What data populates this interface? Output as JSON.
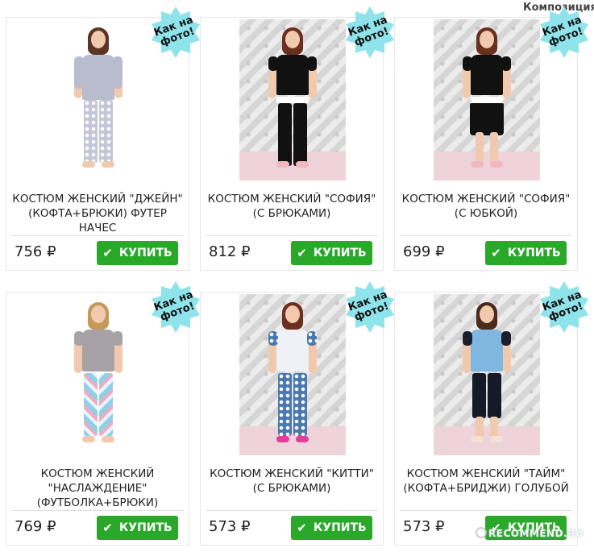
{
  "header": {
    "label": "Композиция"
  },
  "badge_text": "Как на фото!",
  "buy_label": "КУПИТЬ",
  "currency": "₽",
  "products": [
    {
      "title": "КОСТЮМ ЖЕНСКИЙ \"ДЖЕЙН\" (КОФТА+БРЮКИ) ФУТЕР НАЧЕС",
      "price": "756 ₽"
    },
    {
      "title": "КОСТЮМ ЖЕНСКИЙ \"СОФИЯ\" (С БРЮКАМИ)",
      "price": "812 ₽"
    },
    {
      "title": "КОСТЮМ ЖЕНСКИЙ \"СОФИЯ\" (С ЮБКОЙ)",
      "price": "699 ₽"
    },
    {
      "title": "КОСТЮМ ЖЕНСКИЙ \"НАСЛАЖДЕНИЕ\" (ФУТБОЛКА+БРЮКИ)",
      "price": "769 ₽"
    },
    {
      "title": "КОСТЮМ ЖЕНСКИЙ \"КИТТИ\" (С БРЮКАМИ)",
      "price": "573 ₽"
    },
    {
      "title": "КОСТЮМ ЖЕНСКИЙ \"ТАЙМ\" (КОФТА+БРИДЖИ) ГОЛУБОЙ",
      "price": "573 ₽"
    }
  ],
  "watermark": "RECOMMEND.RU",
  "colors": {
    "buy_button": "#29a829",
    "badge": "#8fe3ea"
  }
}
